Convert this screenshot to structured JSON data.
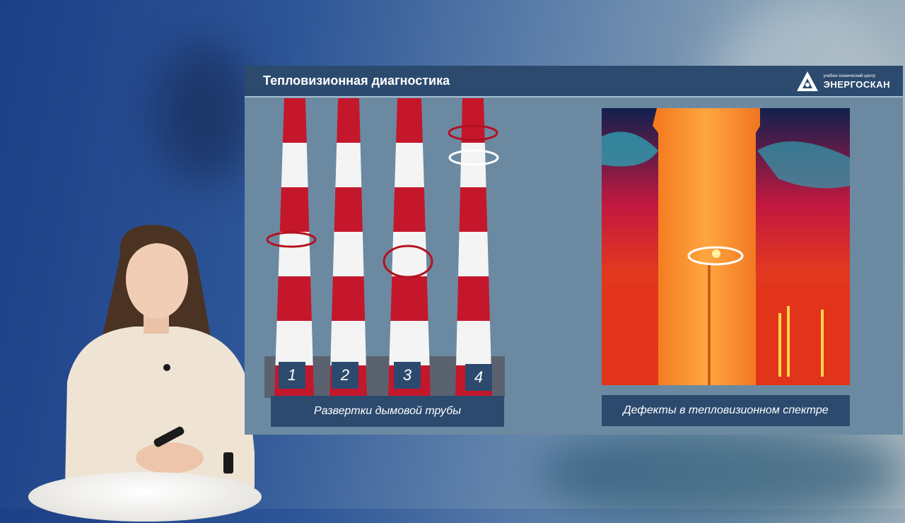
{
  "slide": {
    "title": "Тепловизионная диагностика",
    "logo": {
      "small_text": "учебно-технический центр",
      "brand": "ЭНЕРГОСКАН"
    },
    "chimney_labels": [
      "1",
      "2",
      "3",
      "4"
    ],
    "left_caption": "Развертки дымовой трубы",
    "right_caption": "Дефекты в тепловизионном спектре"
  },
  "colors": {
    "header": "#2b4a6e",
    "slide_bg": "#6b8aa2",
    "chimney_red": "#c4172b",
    "chimney_white": "#f4f4f4",
    "marker_red": "#b3121f",
    "marker_white": "#ffffff"
  }
}
